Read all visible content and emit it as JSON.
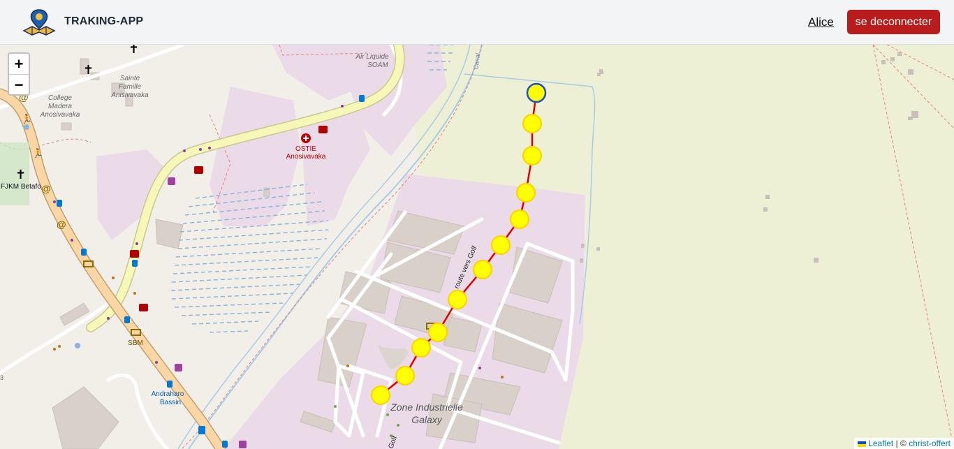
{
  "header": {
    "app_name": "TRAKING-APP",
    "user_name": "Alice",
    "logout_label": "se deconnecter"
  },
  "map": {
    "zoom_in_label": "+",
    "zoom_out_label": "−",
    "place_labels": {
      "air_liquide": "Air Liquide",
      "soam": "SOAM",
      "sainte": "Sainte",
      "famille": "Famille",
      "anisivavaka": "Anisivavaka",
      "college": "College",
      "madera": "Madera",
      "anosivavaka": "Anosivavaka",
      "ostie": "OSTIE",
      "ostie_sub": "Anosivavaka",
      "fjkm": "FJKM Betafo",
      "sbm": "SBM",
      "andraharo": "Andraharo",
      "bassin": "Bassin",
      "zone": "Zone Industrielle",
      "galaxy": "Galaxy",
      "route_golf": "route vers Golf",
      "golf": "Golf",
      "canal": "Canal",
      "edge_number": "3"
    },
    "track_color": "#e00000",
    "marker_fill": "#ffff00",
    "marker_stroke": "#ffd000",
    "start_marker_stroke": "#1d4fc4",
    "track_point_count": 11
  },
  "attribution": {
    "leaflet": "Leaflet",
    "separator": "| ©",
    "author": "christ-offert"
  }
}
